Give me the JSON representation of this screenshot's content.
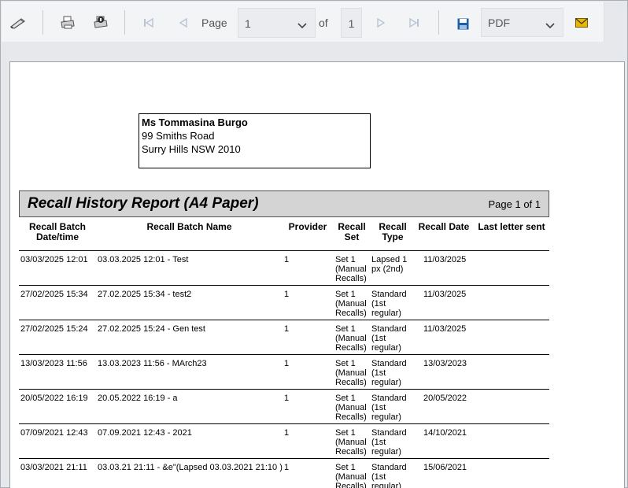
{
  "toolbar": {
    "page_label": "Page",
    "page_value": "1",
    "of_label": "of",
    "page_count": "1",
    "format_value": "PDF"
  },
  "icons": {
    "edit": "pencil-icon",
    "print": "printer-icon",
    "print_setup": "printer-setup-icon",
    "first": "first-page-icon",
    "prev": "previous-page-icon",
    "next": "next-page-icon",
    "last": "last-page-icon",
    "save": "save-icon",
    "email": "email-icon"
  },
  "colors": {
    "email_icon": "#e8b800",
    "save_icon": "#1f5fa8",
    "nav_icon": "#b8c4d6"
  },
  "address": {
    "name": "Ms Tommasina  Burgo",
    "line1": "99 Smiths Road",
    "line2": "Surry Hills NSW 2010"
  },
  "report": {
    "title": "Recall History Report (A4 Paper)",
    "page_info": "Page 1 of 1"
  },
  "columns": {
    "date_l1": "Recall Batch",
    "date_l2": "Date/time",
    "name": "Recall Batch Name",
    "provider": "Provider",
    "set_l1": "Recall",
    "set_l2": "Set",
    "type_l1": "Recall",
    "type_l2": "Type",
    "rdate": "Recall Date",
    "last": "Last letter sent"
  },
  "rows": [
    {
      "date": "03/03/2025 12:01",
      "name": "03.03.2025 12:01 - Test",
      "provider": "1",
      "set": [
        "Set 1",
        "(Manual",
        "Recalls)"
      ],
      "type": [
        "Lapsed 1",
        "px (2nd)"
      ],
      "rdate": "11/03/2025"
    },
    {
      "date": "27/02/2025 15:34",
      "name": "27.02.2025 15:34 - test2",
      "provider": "1",
      "set": [
        "Set 1",
        "(Manual",
        "Recalls)"
      ],
      "type": [
        "Standard",
        "(1st",
        "regular)"
      ],
      "rdate": "11/03/2025"
    },
    {
      "date": "27/02/2025 15:24",
      "name": "27.02.2025 15:24 - Gen test",
      "provider": "1",
      "set": [
        "Set 1",
        "(Manual",
        "Recalls)"
      ],
      "type": [
        "Standard",
        "(1st",
        "regular)"
      ],
      "rdate": "11/03/2025"
    },
    {
      "date": "13/03/2023 11:56",
      "name": "13.03.2023 11:56 - MArch23",
      "provider": "1",
      "set": [
        "Set 1",
        "(Manual",
        "Recalls)"
      ],
      "type": [
        "Standard",
        "(1st",
        "regular)"
      ],
      "rdate": "13/03/2023"
    },
    {
      "date": "20/05/2022 16:19",
      "name": "20.05.2022 16:19 - a",
      "provider": "1",
      "set": [
        "Set 1",
        "(Manual",
        "Recalls)"
      ],
      "type": [
        "Standard",
        "(1st",
        "regular)"
      ],
      "rdate": "20/05/2022"
    },
    {
      "date": "07/09/2021 12:43",
      "name": "07.09.2021 12:43 - 2021",
      "provider": "1",
      "set": [
        "Set 1",
        "(Manual",
        "Recalls)"
      ],
      "type": [
        "Standard",
        "(1st",
        "regular)"
      ],
      "rdate": "14/10/2021"
    },
    {
      "date": "03/03/2021 21:11",
      "name": "03.03.21 21:11 - &e\"(Lapsed 03.03.2021 21:10 )",
      "provider": "1",
      "set": [
        "Set 1",
        "(Manual",
        "Recalls)"
      ],
      "type": [
        "Standard",
        "(1st",
        "regular)"
      ],
      "rdate": "15/06/2021"
    }
  ]
}
